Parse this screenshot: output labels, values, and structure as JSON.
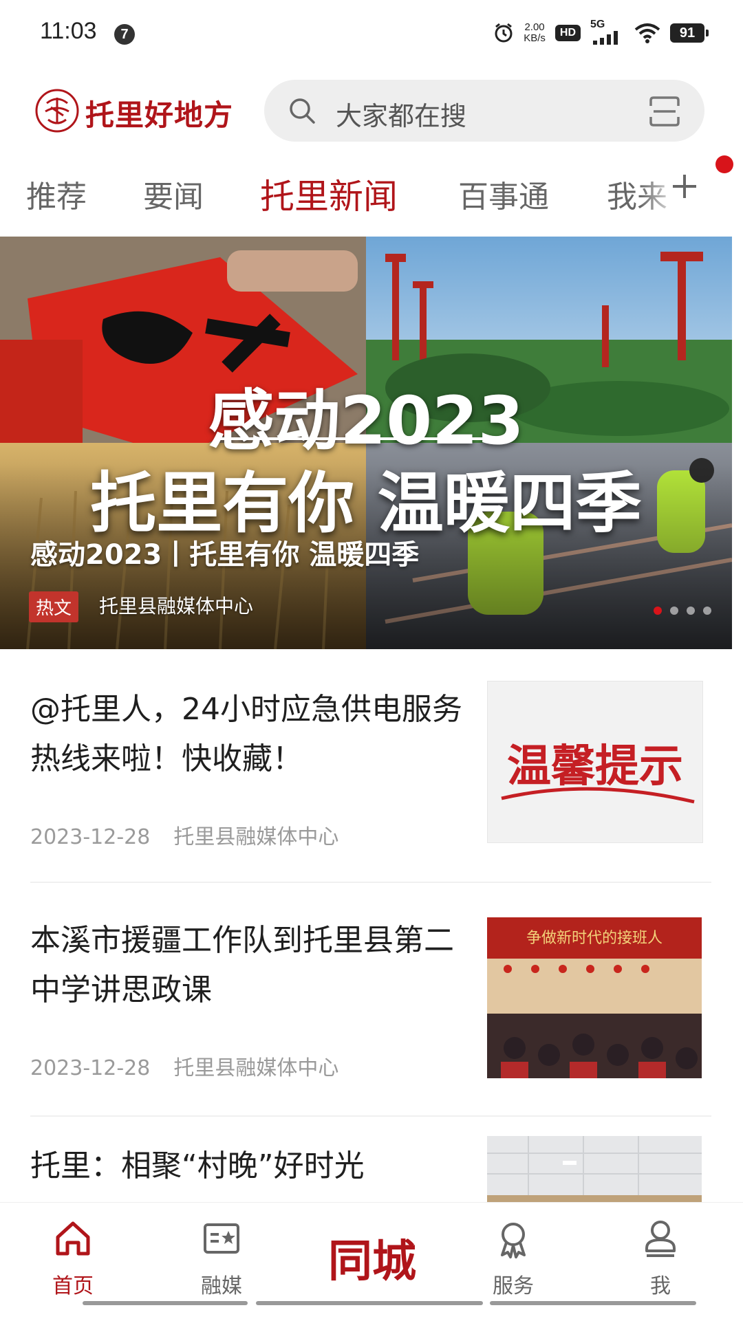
{
  "status_bar": {
    "time": "11:03",
    "notification_count": "7",
    "net_speed_value": "2.00",
    "net_speed_unit": "KB/s",
    "hd_label": "HD",
    "network_label": "5G",
    "battery": "91"
  },
  "header": {
    "app_name": "托里好地方",
    "search_placeholder": "大家都在搜"
  },
  "tabs": [
    {
      "label": "推荐"
    },
    {
      "label": "要闻"
    },
    {
      "label": "托里新闻",
      "active": true
    },
    {
      "label": "百事通"
    },
    {
      "label": "我来"
    }
  ],
  "banner": {
    "headline_big": "感动2023",
    "slogan_big": "托里有你 温暖四季",
    "title": "感动2023丨托里有你 温暖四季",
    "tag": "热文",
    "source": "托里县融媒体中心",
    "slide_count": 4,
    "active_slide": 1
  },
  "news": [
    {
      "title": "@托里人，24小时应急供电服务热线来啦！快收藏！",
      "date": "2023-12-28",
      "source": "托里县融媒体中心",
      "thumb_text": "温馨提示"
    },
    {
      "title": "本溪市援疆工作队到托里县第二中学讲思政课",
      "date": "2023-12-28",
      "source": "托里县融媒体中心",
      "thumb_text": "争做新时代的接班人"
    },
    {
      "title": "托里：相聚“村晚”好时光",
      "date": "",
      "source": ""
    }
  ],
  "bottom_nav": {
    "home": "首页",
    "media": "融媒",
    "center": "同城",
    "service": "服务",
    "me": "我"
  },
  "colors": {
    "brand": "#b0151a",
    "badge_red": "#c2342c"
  }
}
